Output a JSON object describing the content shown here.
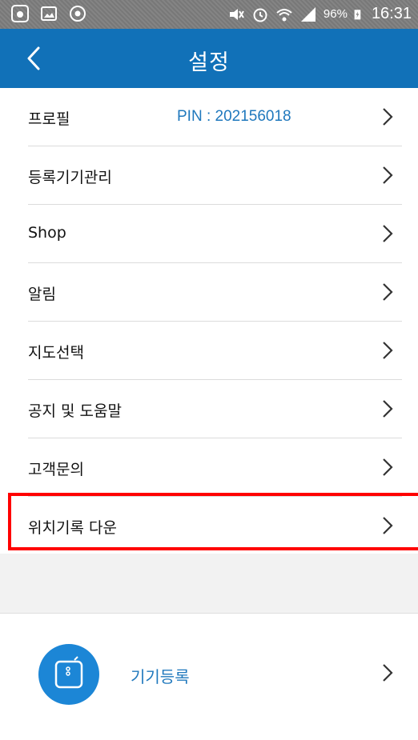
{
  "status_bar": {
    "left_icons": [
      "usb-debug-icon",
      "image-notification-icon",
      "chrome-icon"
    ],
    "right_icons": [
      "mute-icon",
      "alarm-icon",
      "wifi-icon",
      "signal-icon",
      "battery-charging-icon"
    ],
    "battery": "96%",
    "time": "16:31"
  },
  "header": {
    "title": "설정",
    "background": "#1171b8"
  },
  "menu": {
    "items": [
      {
        "label": "프로필",
        "value": "PIN : 202156018"
      },
      {
        "label": "등록기기관리"
      },
      {
        "label": "Shop"
      },
      {
        "label": "알림"
      },
      {
        "label": "지도선택"
      },
      {
        "label": "공지 및 도움말"
      },
      {
        "label": "고객문의"
      },
      {
        "label": "위치기록 다운"
      }
    ]
  },
  "device_register": {
    "label": "기기등록"
  },
  "colors": {
    "accent": "#1f78bd",
    "highlight": "#ff0000"
  }
}
